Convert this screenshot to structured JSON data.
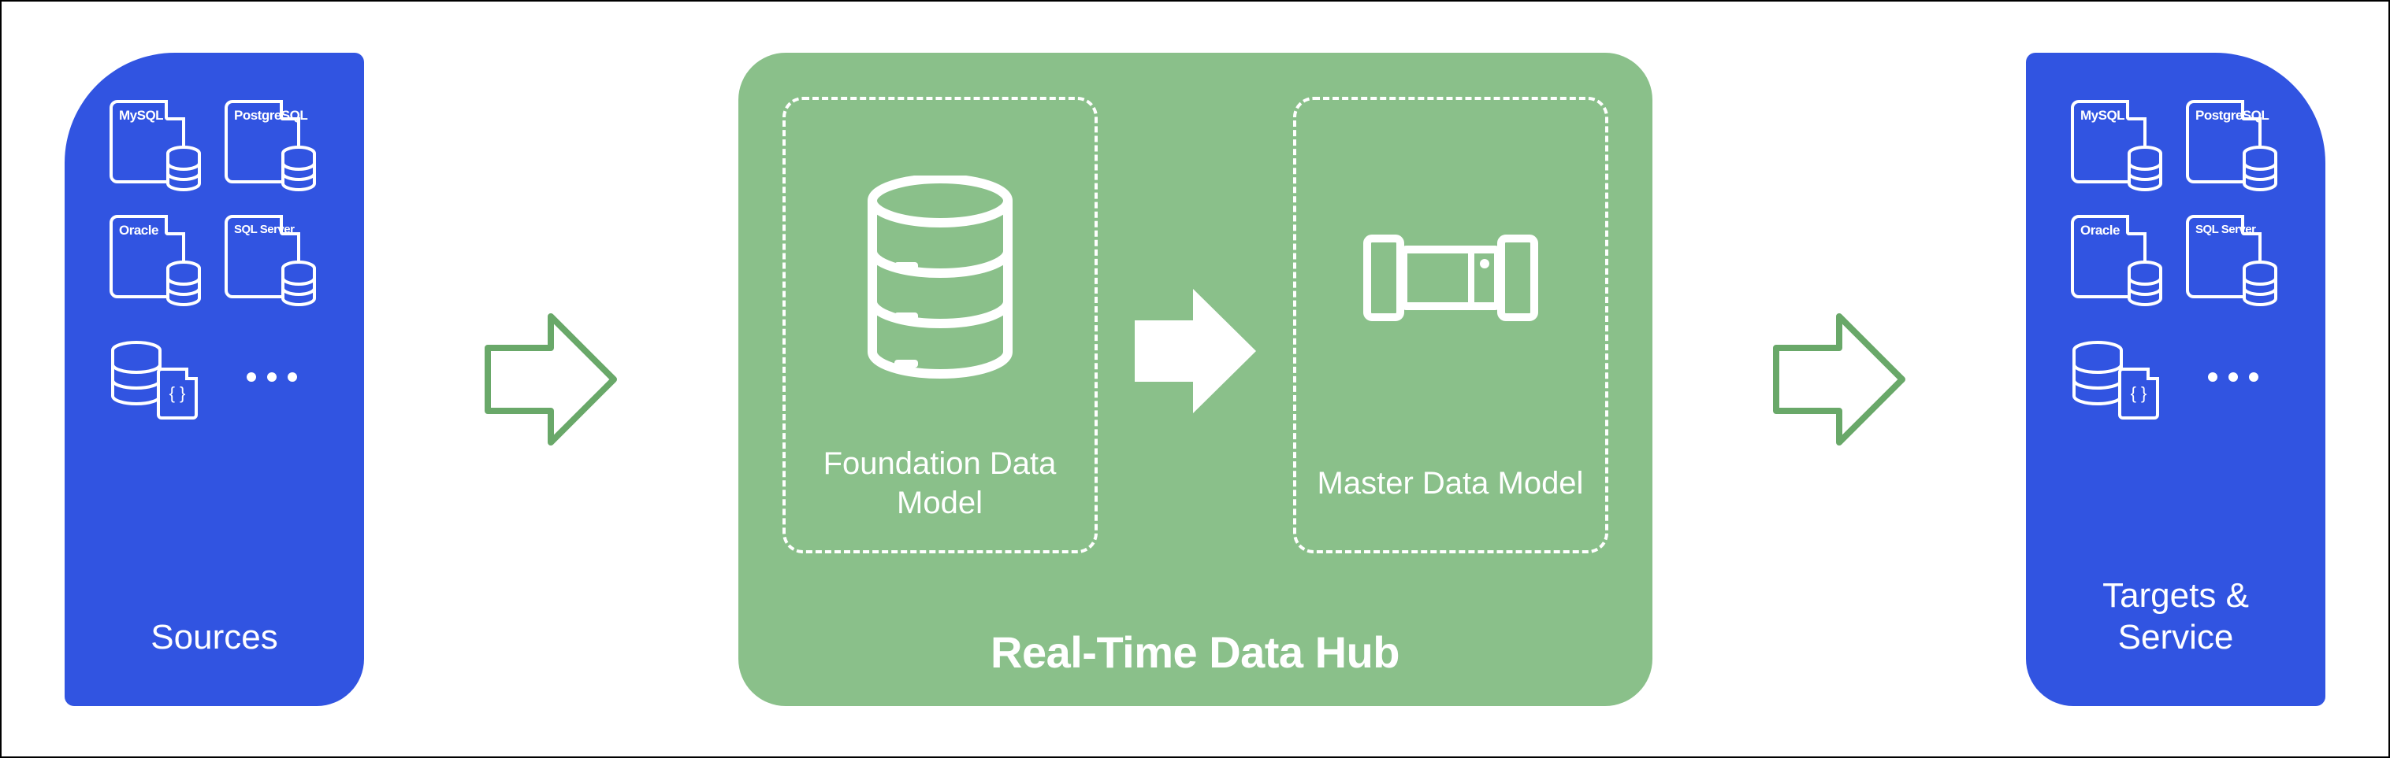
{
  "colors": {
    "blue": "#3154e1",
    "green": "#8ac08a",
    "green_stroke": "#7fb87f",
    "white": "#ffffff"
  },
  "sources": {
    "title": "Sources",
    "items": [
      "MySQL",
      "PostgreSQL",
      "Oracle",
      "SQL Server"
    ]
  },
  "hub": {
    "title": "Real-Time Data Hub",
    "foundation_label": "Foundation Data Model",
    "master_label": "Master Data Model"
  },
  "targets": {
    "title": "Targets & Service",
    "items": [
      "MySQL",
      "PostgreSQL",
      "Oracle",
      "SQL Server"
    ]
  }
}
